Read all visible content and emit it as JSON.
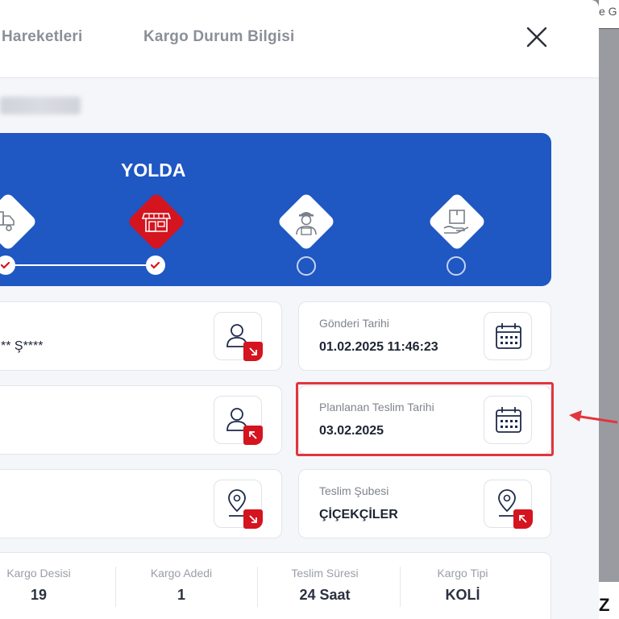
{
  "backdrop": {
    "top_text": "e G",
    "bottom_text": "Z"
  },
  "header": {
    "tabs": [
      {
        "label": "Hareketleri"
      },
      {
        "label": "Kargo Durum Bilgisi"
      }
    ]
  },
  "status": {
    "title": "YOLDA",
    "steps": [
      {
        "icon": "truck-icon",
        "state": "done"
      },
      {
        "icon": "store-icon",
        "state": "active"
      },
      {
        "icon": "courier-icon",
        "state": "pending"
      },
      {
        "icon": "package-hand-icon",
        "state": "pending"
      }
    ]
  },
  "cards": {
    "sender_value": "** Ş****",
    "shipment_date": {
      "label": "Gönderi Tarihi",
      "value": "01.02.2025 11:46:23"
    },
    "planned_delivery": {
      "label": "Planlanan Teslim Tarihi",
      "value": "03.02.2025"
    },
    "delivery_branch": {
      "label": "Teslim Şubesi",
      "value": "ÇİÇEKÇİLER"
    }
  },
  "stats": [
    {
      "label": "Kargo Desisi",
      "value": "19"
    },
    {
      "label": "Kargo Adedi",
      "value": "1"
    },
    {
      "label": "Teslim Süresi",
      "value": "24 Saat"
    },
    {
      "label": "Kargo Tipi",
      "value": "KOLİ"
    }
  ],
  "colors": {
    "primary_blue": "#1f57c3",
    "accent_red": "#d4141f",
    "highlight_red": "#e2353c"
  }
}
